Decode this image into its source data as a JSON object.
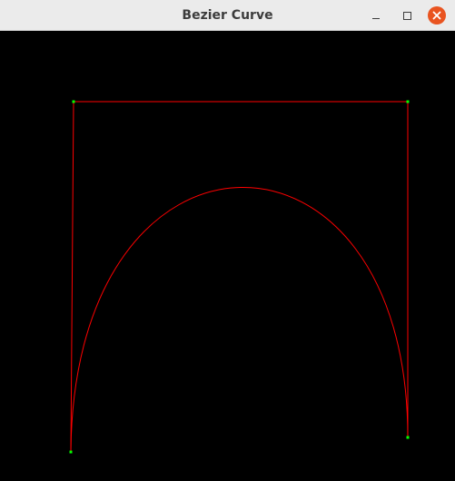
{
  "window": {
    "title": "Bezier Curve"
  },
  "controls": {
    "minimize_icon": "minimize-icon",
    "maximize_icon": "maximize-icon",
    "close_icon": "close-icon"
  },
  "colors": {
    "curve": "#ff0000",
    "control_polygon": "#ff0000",
    "control_point": "#00ff00",
    "background": "#000000",
    "close_button": "#e95420"
  }
}
